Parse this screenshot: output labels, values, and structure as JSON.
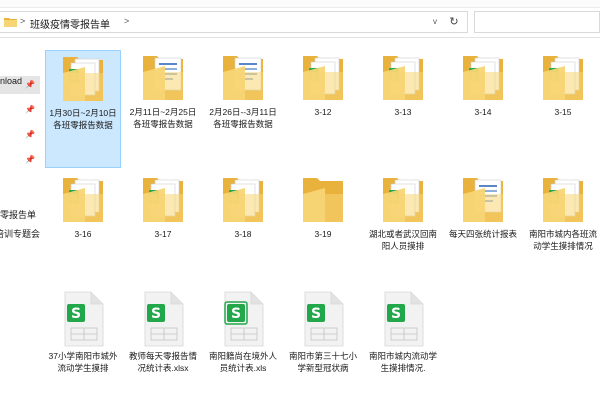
{
  "address": {
    "separator": ">",
    "path": "班级疫情零报告单",
    "dropdown": "v",
    "refresh": "↻"
  },
  "sidebar": {
    "items": [
      {
        "label": "nload",
        "pinned": true,
        "selected": true
      },
      {
        "label": "",
        "pinned": true
      },
      {
        "label": "",
        "pinned": true
      },
      {
        "label": "",
        "pinned": true
      },
      {
        "label": "零报告单",
        "pinned": false
      },
      {
        "label": "培训专题会",
        "pinned": false
      }
    ],
    "pin_glyph": "📌"
  },
  "items": [
    {
      "label": "1月30日~2月10日各班零报告数据",
      "type": "folder-sheet"
    },
    {
      "label": "2月11日~2月25日各班零报告数据",
      "type": "folder-doc"
    },
    {
      "label": "2月26日--3月11日各班零报告数据",
      "type": "folder-doc"
    },
    {
      "label": "3-12",
      "type": "folder-sheet"
    },
    {
      "label": "3-13",
      "type": "folder-sheet"
    },
    {
      "label": "3-14",
      "type": "folder-sheet"
    },
    {
      "label": "3-15",
      "type": "folder-sheet"
    },
    {
      "label": "3-16",
      "type": "folder-sheet"
    },
    {
      "label": "3-17",
      "type": "folder-sheet"
    },
    {
      "label": "3-18",
      "type": "folder-sheet"
    },
    {
      "label": "3-19",
      "type": "folder-empty"
    },
    {
      "label": "湖北或者武汉回南阳人员摸排",
      "type": "folder-sheet"
    },
    {
      "label": "每天四张统计报表",
      "type": "folder-doc"
    },
    {
      "label": "南阳市城内各班流动学生摸排情况",
      "type": "folder-sheet"
    },
    {
      "label": "37小学南阳市城外流动学生摸排",
      "type": "xlsx"
    },
    {
      "label": "教师每天零报告情况统计表.xlsx",
      "type": "xlsx"
    },
    {
      "label": "南阳籍尚在境外人员统计表.xls",
      "type": "xls"
    },
    {
      "label": "南阳市第三十七小学新型冠状病",
      "type": "xlsx"
    },
    {
      "label": "南阳市城内流动学生摸排情况.",
      "type": "xlsx"
    }
  ],
  "colors": {
    "folder_back": "#e8b23c",
    "folder_front": "#f8d574",
    "sheet_green": "#22a84a",
    "selection": "#cce8ff"
  }
}
